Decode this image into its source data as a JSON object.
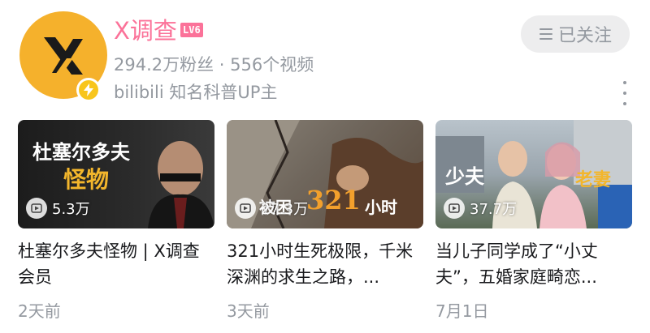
{
  "channel": {
    "name": "X调查",
    "level": "LV6",
    "stats": "294.2万粉丝 · 556个视频",
    "tagline": "bilibili 知名科普UP主",
    "follow_label": "已关注",
    "colors": {
      "accent": "#fb7299",
      "avatar_bg": "#f5b12c",
      "muted": "#9499a0"
    }
  },
  "videos": [
    {
      "thumb_text_line1": "杜塞尔多夫",
      "thumb_text_line2": "怪物",
      "plays": "5.3万",
      "title": "杜塞尔多夫怪物 | X调查会员",
      "date": "2天前"
    },
    {
      "thumb_text_line1": "被困",
      "thumb_text_line2": "321",
      "thumb_text_line3": "小时",
      "plays": "27.3万",
      "title": "321小时生死极限，千米深渊的求生之路，...",
      "date": "3天前"
    },
    {
      "thumb_text_line1": "少夫",
      "thumb_text_line2": "老妻",
      "plays": "37.7万",
      "title": "当儿子同学成了“小丈夫”，五婚家庭畸恋...",
      "date": "7月1日"
    }
  ],
  "icons": [
    "x-logo-icon",
    "lightning-verify-icon",
    "menu-lines-icon",
    "more-vertical-icon",
    "play-icon"
  ]
}
